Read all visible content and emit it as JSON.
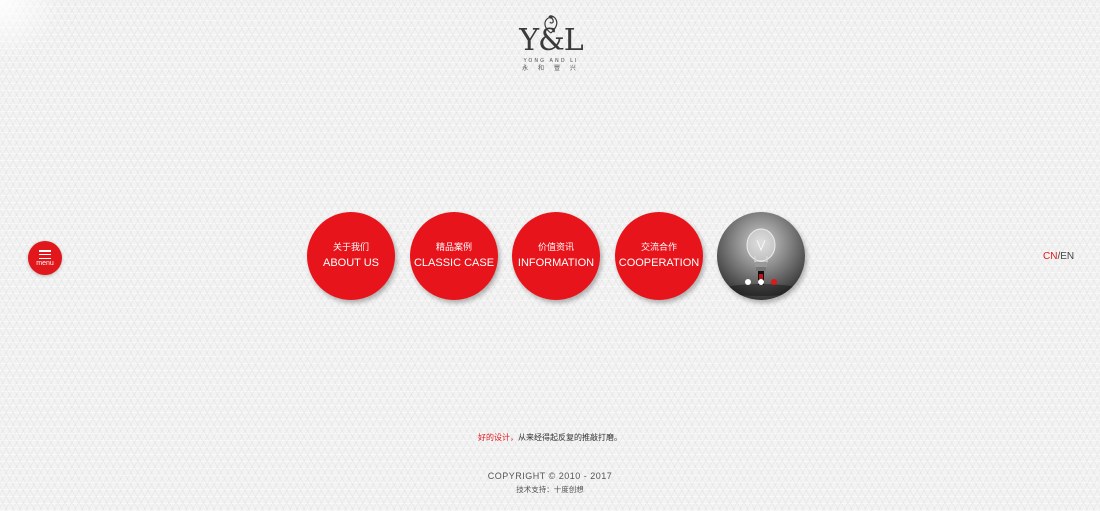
{
  "brand": {
    "logo_mark": "Y&L",
    "logo_sub_en": "YONG AND LI",
    "logo_sub_cn": "永 和 豐 兴"
  },
  "menu": {
    "label": "menu",
    "icon": "hamburger-icon",
    "color": "#e1171b"
  },
  "nav": [
    {
      "cn": "关于我们",
      "en": "ABOUT US"
    },
    {
      "cn": "精品案例",
      "en": "CLASSIC CASE"
    },
    {
      "cn": "价值资讯",
      "en": "INFORMATION"
    },
    {
      "cn": "交流合作",
      "en": "COOPERATION"
    }
  ],
  "slider": {
    "image": "light-bulb-photo",
    "dots": 3,
    "active_dot": 3
  },
  "lang": {
    "cn": "CN",
    "sep": "/",
    "en": "EN",
    "active": "CN"
  },
  "footer": {
    "slogan_highlight": "好的设计，",
    "slogan_rest": "从来经得起反复的推敲打磨。",
    "copyright": "COPYRIGHT © 2010 - 2017",
    "support": "技术支持：十度创想"
  },
  "colors": {
    "accent": "#e1171b",
    "circle": "#e8141b",
    "background": "#f3f3f3"
  }
}
